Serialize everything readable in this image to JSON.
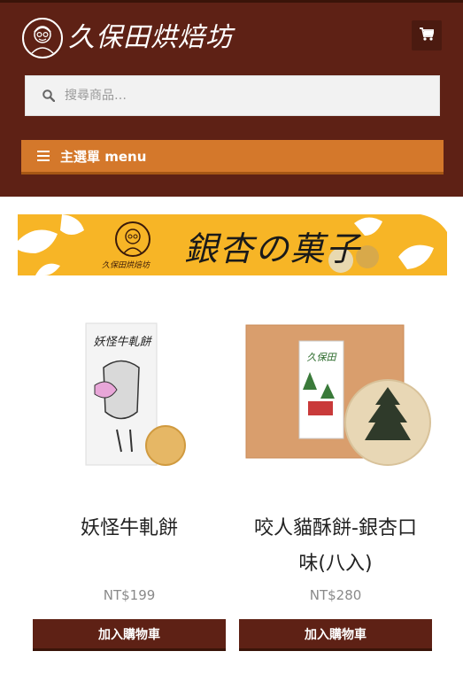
{
  "header": {
    "brand_text": "久保田烘焙坊",
    "cart_icon": "shopping-cart-icon",
    "background_color": "#5e2115"
  },
  "search": {
    "placeholder": "搜尋商品…",
    "icon": "search-icon"
  },
  "menu": {
    "label": "主選單 menu",
    "icon": "hamburger-icon",
    "color": "#d4782b"
  },
  "banner": {
    "title": "銀杏の菓子",
    "brand": "久保田烘焙坊",
    "color": "#f7b526"
  },
  "products": [
    {
      "name": "妖怪牛軋餅",
      "price": "NT$199",
      "button_label": "加入購物車",
      "package_text": "妖怪牛軋餅"
    },
    {
      "name": "咬人貓酥餅-銀杏口味(八入)",
      "name_line1": "咬人貓酥餅-銀杏口",
      "name_line2": "味(八入)",
      "price": "NT$280",
      "button_label": "加入購物車",
      "package_text": "久保田"
    }
  ]
}
